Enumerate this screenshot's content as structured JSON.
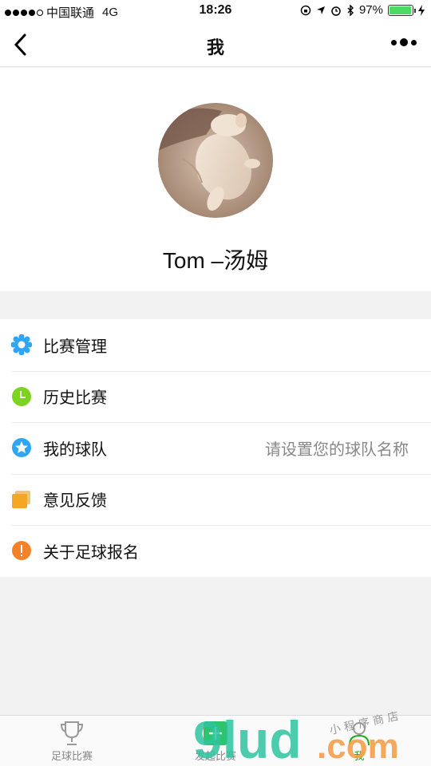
{
  "status_bar": {
    "carrier": "中国联通",
    "network": "4G",
    "time": "18:26",
    "battery_percent": "97%",
    "battery_level": 0.97
  },
  "nav": {
    "title": "我"
  },
  "profile": {
    "name": "Tom –汤姆"
  },
  "menu": {
    "items": [
      {
        "label": "比赛管理",
        "icon": "gear-icon",
        "color": "#2fa5f5"
      },
      {
        "label": "历史比赛",
        "icon": "clock-icon",
        "color": "#7ed321"
      },
      {
        "label": "我的球队",
        "icon": "star-badge-icon",
        "color": "#2fa5f5",
        "value": "请设置您的球队名称"
      },
      {
        "label": "意见反馈",
        "icon": "feedback-icon",
        "color": "#f5a623"
      },
      {
        "label": "关于足球报名",
        "icon": "info-icon",
        "color": "#f5822a"
      }
    ]
  },
  "tab_bar": {
    "tabs": [
      {
        "label": "足球比赛",
        "icon": "trophy-icon"
      },
      {
        "label": "发起比赛",
        "icon": "plus-icon"
      },
      {
        "label": "我",
        "icon": "person-icon",
        "active": true
      }
    ]
  },
  "watermark": {
    "text": "9lud.com",
    "subtext": "小程序商店"
  }
}
